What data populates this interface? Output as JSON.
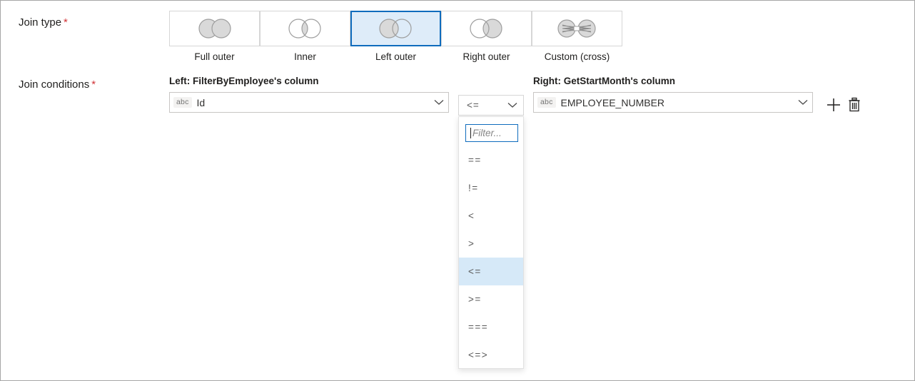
{
  "form": {
    "join_type": {
      "label": "Join type",
      "required_marker": "*",
      "options": [
        {
          "label": "Full outer",
          "icon": "venn-full-outer-icon",
          "selected": false
        },
        {
          "label": "Inner",
          "icon": "venn-inner-icon",
          "selected": false
        },
        {
          "label": "Left outer",
          "icon": "venn-left-outer-icon",
          "selected": true
        },
        {
          "label": "Right outer",
          "icon": "venn-right-outer-icon",
          "selected": false
        },
        {
          "label": "Custom (cross)",
          "icon": "venn-custom-cross-icon",
          "selected": false
        }
      ]
    },
    "join_conditions": {
      "label": "Join conditions",
      "required_marker": "*",
      "left": {
        "header": "Left: FilterByEmployee's column",
        "type_badge": "abc",
        "value": "Id",
        "chevron_icon": "chevron-down-icon"
      },
      "operator": {
        "value": "<=",
        "chevron_icon": "chevron-down-icon"
      },
      "right": {
        "header": "Right: GetStartMonth's column",
        "type_badge": "abc",
        "value": "EMPLOYEE_NUMBER",
        "chevron_icon": "chevron-down-icon"
      },
      "actions": {
        "add_icon": "plus-icon",
        "delete_icon": "trash-icon"
      }
    },
    "operator_dropdown": {
      "filter_placeholder": "Filter...",
      "options": [
        {
          "label": "==",
          "selected": false
        },
        {
          "label": "!=",
          "selected": false
        },
        {
          "label": "<",
          "selected": false
        },
        {
          "label": ">",
          "selected": false
        },
        {
          "label": "<=",
          "selected": true
        },
        {
          "label": ">=",
          "selected": false
        },
        {
          "label": "===",
          "selected": false
        },
        {
          "label": "<=>",
          "selected": false
        }
      ]
    }
  },
  "colors": {
    "accent": "#0f6cbd",
    "selected_tile_fill": "#deecf9",
    "dropdown_highlight": "#d6e9f8",
    "required_star": "#d13438",
    "venn_fill": "#d9d9d9",
    "venn_stroke": "#9e9e9e"
  }
}
